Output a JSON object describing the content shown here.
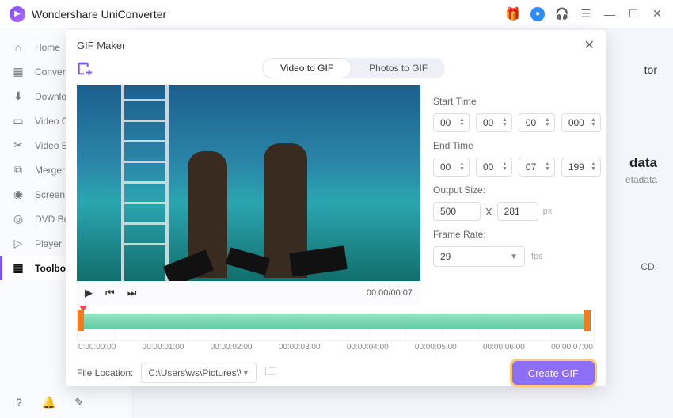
{
  "app_title": "Wondershare UniConverter",
  "sidebar": {
    "items": [
      {
        "label": "Home",
        "icon": "⌂"
      },
      {
        "label": "Converter",
        "icon": "▦"
      },
      {
        "label": "Downloader",
        "icon": "⬇"
      },
      {
        "label": "Video Compressor",
        "icon": "▭"
      },
      {
        "label": "Video Editor",
        "icon": "✂"
      },
      {
        "label": "Merger",
        "icon": "⧉"
      },
      {
        "label": "Screen Recorder",
        "icon": "◉"
      },
      {
        "label": "DVD Burner",
        "icon": "◎"
      },
      {
        "label": "Player",
        "icon": "▷"
      },
      {
        "label": "Toolbox",
        "icon": "▦"
      }
    ]
  },
  "bg": {
    "top_right": "tor",
    "meta_heading": "data",
    "meta_line": "etadata",
    "cd_hint": "CD."
  },
  "modal": {
    "title": "GIF Maker",
    "tabs": {
      "video": "Video to GIF",
      "photos": "Photos to GIF"
    },
    "controls": {
      "time_display": "00:00/00:07"
    },
    "settings": {
      "start_label": "Start Time",
      "start": {
        "hh": "00",
        "mm": "00",
        "ss": "00",
        "ms": "000"
      },
      "end_label": "End Time",
      "end": {
        "hh": "00",
        "mm": "00",
        "ss": "07",
        "ms": "199"
      },
      "size_label": "Output Size:",
      "size": {
        "w": "500",
        "h": "281",
        "mul": "X",
        "px": "px"
      },
      "rate_label": "Frame Rate:",
      "rate_value": "29",
      "fps": "fps"
    },
    "timeline": {
      "ticks": [
        "0:00:00:00",
        "00:00:01:00",
        "00:00:02:00",
        "00:00:03:00",
        "00:00:04:00",
        "00:00:05:00",
        "00:00:06:00",
        "00:00:07:00"
      ]
    },
    "file_location_label": "File Location:",
    "file_location": "C:\\Users\\ws\\Pictures\\Wonders",
    "create_label": "Create GIF"
  }
}
